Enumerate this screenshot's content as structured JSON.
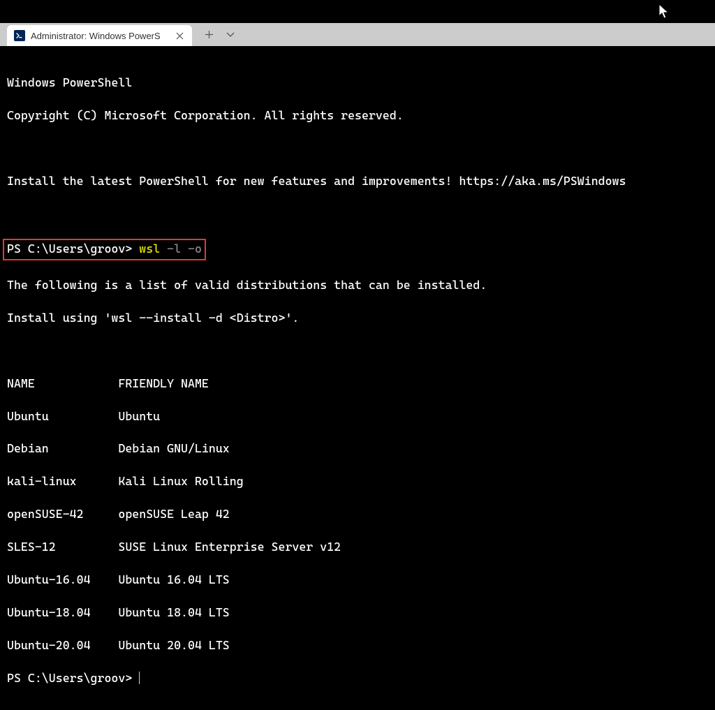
{
  "tab": {
    "title": "Administrator: Windows PowerS"
  },
  "terminal": {
    "header1": "Windows PowerShell",
    "header2": "Copyright (C) Microsoft Corporation. All rights reserved.",
    "install_msg": "Install the latest PowerShell for new features and improvements! https://aka.ms/PSWindows",
    "prompt1": "PS C:\\Users\\groov> ",
    "cmd_wsl": "wsl",
    "cmd_flags": " -l -o",
    "list_intro1": "The following is a list of valid distributions that can be installed.",
    "list_intro2": "Install using 'wsl --install -d <Distro>'.",
    "table_header": "NAME            FRIENDLY NAME",
    "rows": [
      "Ubuntu          Ubuntu",
      "Debian          Debian GNU/Linux",
      "kali-linux      Kali Linux Rolling",
      "openSUSE-42     openSUSE Leap 42",
      "SLES-12         SUSE Linux Enterprise Server v12",
      "Ubuntu-16.04    Ubuntu 16.04 LTS",
      "Ubuntu-18.04    Ubuntu 18.04 LTS",
      "Ubuntu-20.04    Ubuntu 20.04 LTS"
    ],
    "prompt2": "PS C:\\Users\\groov> "
  },
  "chart_data": {
    "type": "table",
    "title": "WSL distributions available for install",
    "columns": [
      "NAME",
      "FRIENDLY NAME"
    ],
    "rows": [
      [
        "Ubuntu",
        "Ubuntu"
      ],
      [
        "Debian",
        "Debian GNU/Linux"
      ],
      [
        "kali-linux",
        "Kali Linux Rolling"
      ],
      [
        "openSUSE-42",
        "openSUSE Leap 42"
      ],
      [
        "SLES-12",
        "SUSE Linux Enterprise Server v12"
      ],
      [
        "Ubuntu-16.04",
        "Ubuntu 16.04 LTS"
      ],
      [
        "Ubuntu-18.04",
        "Ubuntu 18.04 LTS"
      ],
      [
        "Ubuntu-20.04",
        "Ubuntu 20.04 LTS"
      ]
    ]
  }
}
